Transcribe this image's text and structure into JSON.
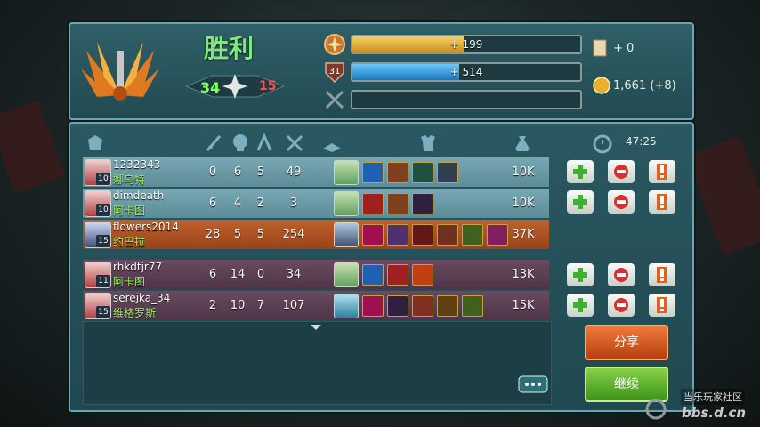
{
  "result": {
    "title": "胜利",
    "kills": "34",
    "deaths": "15"
  },
  "rewards": {
    "xp_label": "+ 199",
    "xp_progress": 0.49,
    "level": "31",
    "level_label": "+ 514",
    "level_progress": 0.47,
    "scroll_count": "+ 0",
    "gold_total": "1,661 (+8)"
  },
  "table": {
    "timer": "47:25",
    "team_self": [
      {
        "player": "1232343",
        "hero": "娜乌特",
        "level": "10",
        "kills": "0",
        "deaths": "6",
        "assists": "5",
        "creeps": "49",
        "gold": "10K",
        "items": [
          "item-blue-gem",
          "item-gold-ring",
          "item-green-boot",
          "item-axe"
        ]
      },
      {
        "player": "dimdeath",
        "hero": "阿卡图",
        "level": "10",
        "kills": "6",
        "deaths": "4",
        "assists": "2",
        "creeps": "3",
        "gold": "10K",
        "items": [
          "item-red-blade",
          "item-gold-ring",
          "item-boot"
        ]
      },
      {
        "player": "flowers2014",
        "hero": "约巴拉",
        "level": "15",
        "kills": "28",
        "deaths": "5",
        "assists": "5",
        "creeps": "254",
        "gold": "37K",
        "items": [
          "item-orb",
          "item-claw",
          "item-hood",
          "item-boot",
          "item-totem",
          "item-staff"
        ]
      }
    ],
    "team_other": [
      {
        "player": "rhkdtjr77",
        "hero": "阿卡图",
        "level": "11",
        "kills": "6",
        "deaths": "14",
        "assists": "0",
        "creeps": "34",
        "gold": "13K",
        "items": [
          "item-blue-gem",
          "item-red-blade",
          "item-fire-sword"
        ]
      },
      {
        "player": "serejka_34",
        "hero": "维格罗斯",
        "level": "15",
        "kills": "2",
        "deaths": "10",
        "assists": "7",
        "creeps": "107",
        "gold": "15K",
        "items": [
          "item-orb",
          "item-boot",
          "item-sword",
          "item-ring",
          "item-totem"
        ]
      }
    ]
  },
  "buttons": {
    "share": "分享",
    "continue": "继续"
  },
  "watermark": {
    "line1": "当乐玩家社区",
    "line2": "bbs.d.cn"
  },
  "colors": {
    "xp_bar": "#e8b83a",
    "level_bar": "#3aa8e8",
    "kills": "#80ff60",
    "deaths": "#ff5050",
    "hero_name": "#9ff26a"
  }
}
